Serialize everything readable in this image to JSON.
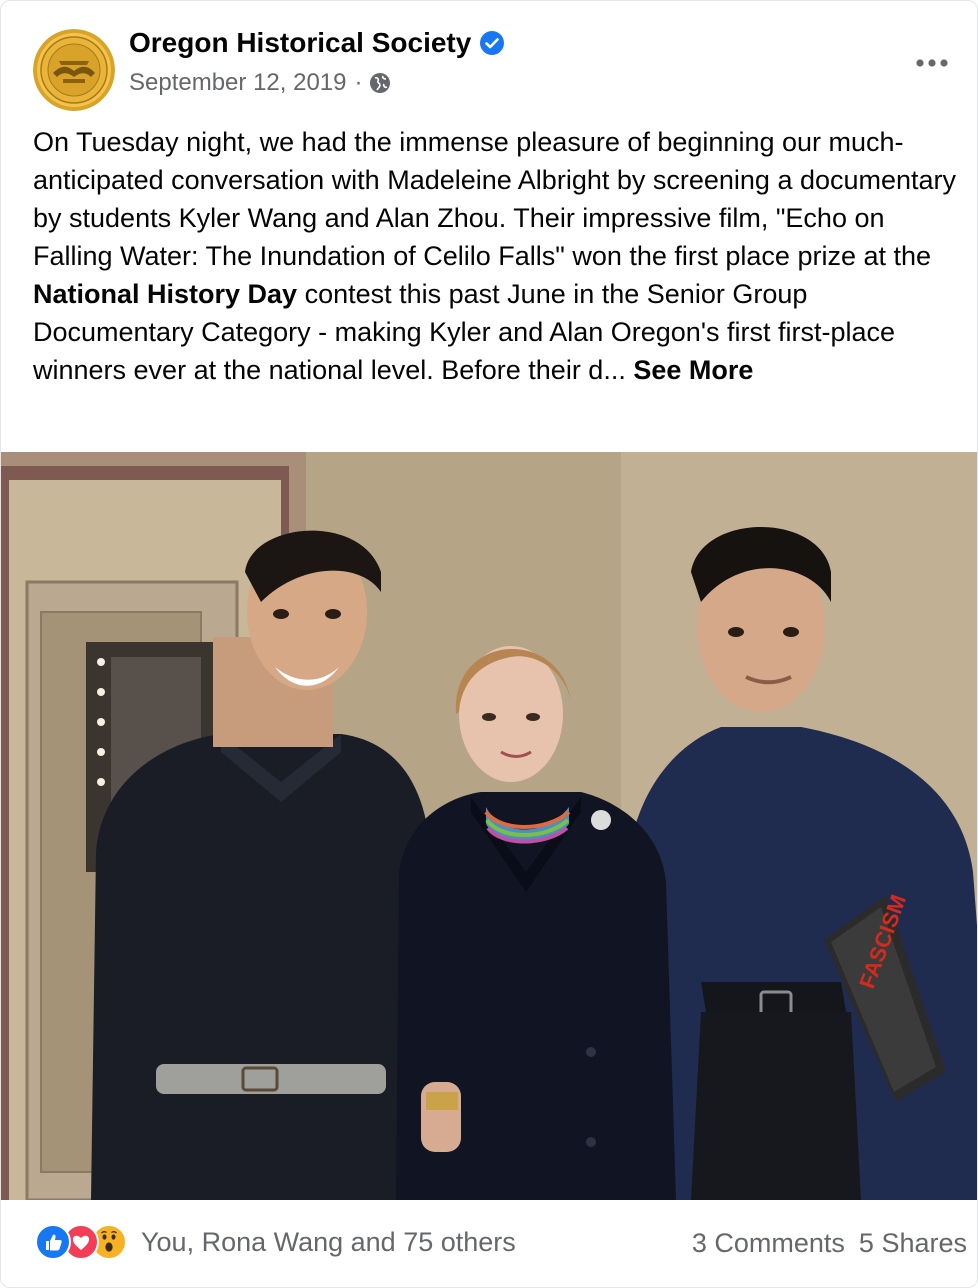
{
  "post": {
    "page_name": "Oregon Historical Society",
    "date": "September 12, 2019",
    "separator": "·",
    "privacy_icon": "globe-icon",
    "verified_icon": "verified-badge-icon",
    "more_icon": "more-options-icon",
    "text_part1": "On Tuesday night, we had the immense pleasure of beginning our much-anticipated conversation with Madeleine Albright by screening a documentary by students Kyler Wang and Alan Zhou. Their impressive film, \"Echo on Falling Water: The Inundation of Celilo Falls\" won the first place prize at the ",
    "text_bold": "National History Day",
    "text_part2": " contest this past June in the Senior Group Documentary Category - making Kyler and Alan Oregon's first first-place winners ever at the national level. Before their d... ",
    "see_more": "See More"
  },
  "photo": {
    "book_title": "FASCISM"
  },
  "footer": {
    "reactions_text": "You, Rona Wang and 75 others",
    "reaction_icons": [
      "like-icon",
      "love-icon",
      "wow-icon"
    ],
    "comments": "3 Comments",
    "shares": "5 Shares"
  },
  "colors": {
    "brand_blue": "#1877f2",
    "love_red": "#f33e58",
    "wow_yellow": "#f7b125",
    "secondary_text": "#65676b"
  }
}
